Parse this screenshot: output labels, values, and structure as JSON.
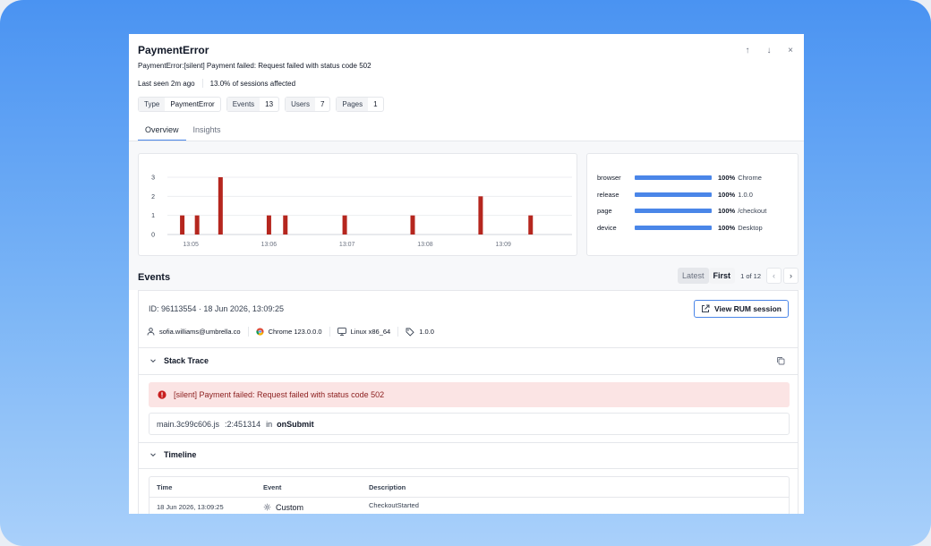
{
  "header": {
    "title": "PaymentError",
    "subtitle": "PaymentError:[silent] Payment failed: Request failed with status code 502",
    "last_seen": "Last seen 2m ago",
    "sessions_affected": "13.0% of sessions affected",
    "controls": {
      "up": "↑",
      "down": "↓",
      "close": "×"
    }
  },
  "chips": [
    {
      "key": "Type",
      "value": "PaymentError"
    },
    {
      "key": "Events",
      "value": "13"
    },
    {
      "key": "Users",
      "value": "7"
    },
    {
      "key": "Pages",
      "value": "1"
    }
  ],
  "tabs": [
    {
      "label": "Overview",
      "active": true
    },
    {
      "label": "Insights",
      "active": false
    }
  ],
  "chart_data": {
    "type": "bar",
    "title": "",
    "xlabel": "",
    "ylabel": "",
    "x_ticks": [
      "13:05",
      "13:06",
      "13:07",
      "13:08",
      "13:09"
    ],
    "y_ticks": [
      0,
      1,
      2,
      3
    ],
    "ylim": [
      0,
      3
    ],
    "xlim_minutes": [
      4.7,
      9.88
    ],
    "bars": [
      {
        "minute": 4.89,
        "value": 1
      },
      {
        "minute": 5.08,
        "value": 1
      },
      {
        "minute": 5.38,
        "value": 3
      },
      {
        "minute": 6.0,
        "value": 1
      },
      {
        "minute": 6.21,
        "value": 1
      },
      {
        "minute": 6.97,
        "value": 1
      },
      {
        "minute": 7.84,
        "value": 1
      },
      {
        "minute": 8.71,
        "value": 2
      },
      {
        "minute": 9.35,
        "value": 1
      }
    ],
    "bar_color": "#b5261e",
    "grid": true
  },
  "tags": [
    {
      "key": "browser",
      "percent": "100%",
      "value": "Chrome",
      "fraction": 1.0
    },
    {
      "key": "release",
      "percent": "100%",
      "value": "1.0.0",
      "fraction": 1.0
    },
    {
      "key": "page",
      "percent": "100%",
      "value": "/checkout",
      "fraction": 1.0
    },
    {
      "key": "device",
      "percent": "100%",
      "value": "Desktop",
      "fraction": 1.0
    }
  ],
  "events": {
    "title": "Events",
    "latest_label": "Latest",
    "first_label": "First",
    "count": "1 of 12",
    "prev": "‹",
    "next": "›"
  },
  "event": {
    "id_line": "ID: 96113554  ·  18 Jun 2026, 13:09:25",
    "rum_button": "View RUM session",
    "user": "sofia.williams@umbrella.co",
    "browser": "Chrome 123.0.0.0",
    "os": "Linux x86_64",
    "release": "1.0.0"
  },
  "stack_trace": {
    "title": "Stack Trace",
    "error_message": "[silent] Payment failed: Request failed with status code 502",
    "file": "main.3c99c606.js",
    "location": ":2:451314",
    "in_label": "in",
    "function": "onSubmit"
  },
  "timeline": {
    "title": "Timeline",
    "columns": [
      "Time",
      "Event",
      "Description"
    ],
    "rows": [
      {
        "time": "18 Jun 2026, 13:09:25",
        "event": "Custom",
        "description": "CheckoutStarted"
      }
    ]
  },
  "colors": {
    "accent": "#4a86e8",
    "error_bg": "#fbe4e4",
    "error_text": "#8b1d1d",
    "bar": "#b5261e"
  }
}
